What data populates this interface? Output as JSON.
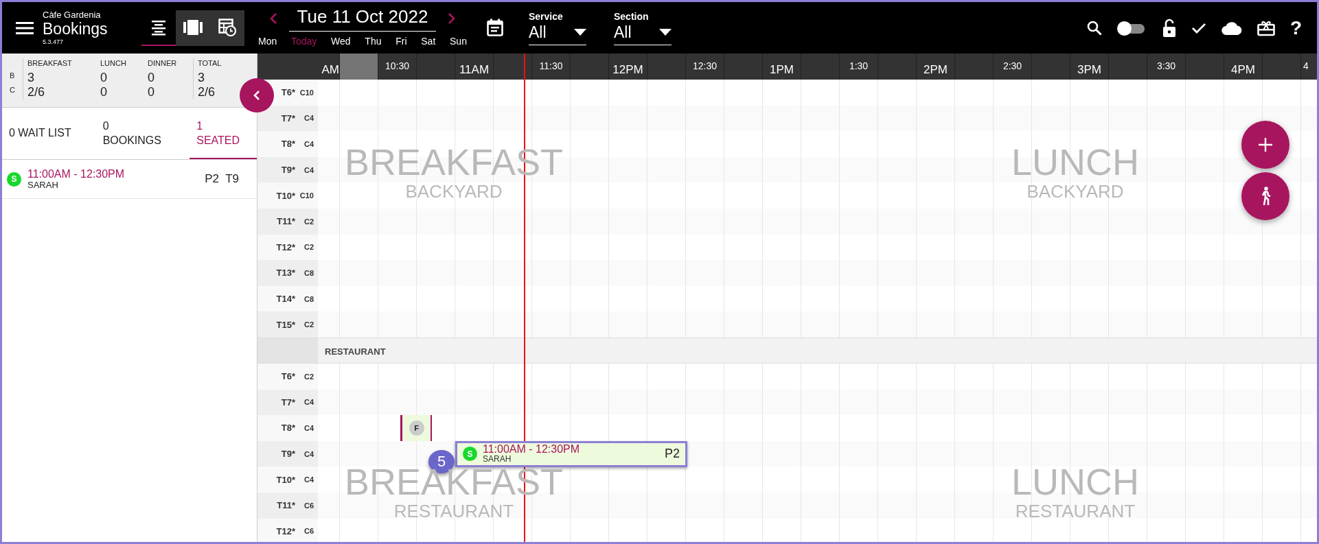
{
  "app": {
    "venue": "Càfe Gardenia",
    "title": "Bookings",
    "version": "5.3.477"
  },
  "view_modes": [
    {
      "kind": "list",
      "selected": true
    },
    {
      "kind": "floor",
      "selected": false
    },
    {
      "kind": "timeline",
      "selected": false
    }
  ],
  "date_nav": {
    "date": "Tue 11 Oct 2022",
    "days": [
      {
        "label": "Mon",
        "selected": false
      },
      {
        "label": "Today",
        "selected": true
      },
      {
        "label": "Wed",
        "selected": false
      },
      {
        "label": "Thu",
        "selected": false
      },
      {
        "label": "Fri",
        "selected": false
      },
      {
        "label": "Sat",
        "selected": false
      },
      {
        "label": "Sun",
        "selected": false
      }
    ]
  },
  "filters": [
    {
      "label": "Service",
      "value": "All"
    },
    {
      "label": "Section",
      "value": "All"
    }
  ],
  "toolbar": {
    "switch_on": false,
    "help": "?"
  },
  "summary": {
    "columns": [
      "BREAKFAST",
      "LUNCH",
      "DINNER",
      "TOTAL"
    ],
    "rows": [
      {
        "label": "B",
        "values": [
          "3",
          "0",
          "0",
          "3"
        ]
      },
      {
        "label": "C",
        "values": [
          "2/6",
          "0",
          "0",
          "2/6"
        ]
      }
    ]
  },
  "tabs": [
    {
      "label": "0 WAIT LIST",
      "selected": false
    },
    {
      "label": "0 BOOKINGS",
      "selected": false
    },
    {
      "label": "1 SEATED",
      "selected": true
    }
  ],
  "seated_list": [
    {
      "status": "S",
      "color": "#16d92c",
      "time": "11:00AM - 12:30PM",
      "name": "SARAH",
      "party": "P2",
      "table": "T9"
    }
  ],
  "timeline": {
    "slots": [
      {
        "label": "AM",
        "kind": "hour",
        "shaded": false
      },
      {
        "kind": "quarter",
        "shaded": true
      },
      {
        "label": "10:30",
        "kind": "half",
        "shaded": false
      },
      {
        "kind": "quarter",
        "shaded": false
      },
      {
        "label": "11AM",
        "kind": "hour",
        "shaded": false
      },
      {
        "kind": "quarter",
        "shaded": false
      },
      {
        "label": "11:30",
        "kind": "half",
        "shaded": false
      },
      {
        "kind": "quarter",
        "shaded": false
      },
      {
        "label": "12PM",
        "kind": "hour",
        "shaded": false
      },
      {
        "kind": "quarter",
        "shaded": false
      },
      {
        "label": "12:30",
        "kind": "half",
        "shaded": false
      },
      {
        "kind": "quarter",
        "shaded": false
      },
      {
        "label": "1PM",
        "kind": "hour",
        "shaded": false
      },
      {
        "kind": "quarter",
        "shaded": false
      },
      {
        "label": "1:30",
        "kind": "half",
        "shaded": false
      },
      {
        "kind": "quarter",
        "shaded": false
      },
      {
        "label": "2PM",
        "kind": "hour",
        "shaded": false
      },
      {
        "kind": "quarter",
        "shaded": false
      },
      {
        "label": "2:30",
        "kind": "half",
        "shaded": false
      },
      {
        "kind": "quarter",
        "shaded": false
      },
      {
        "label": "3PM",
        "kind": "hour",
        "shaded": false
      },
      {
        "kind": "quarter",
        "shaded": false
      },
      {
        "label": "3:30",
        "kind": "half",
        "shaded": false
      },
      {
        "kind": "quarter",
        "shaded": false
      },
      {
        "label": "4PM",
        "kind": "hour",
        "shaded": false
      },
      {
        "kind": "quarter",
        "shaded": false
      },
      {
        "label": "4",
        "kind": "half",
        "shaded": false
      }
    ],
    "sections": [
      {
        "watermarks": [
          {
            "service": "BREAKFAST",
            "area": "BACKYARD"
          },
          {
            "service": "LUNCH",
            "area": "BACKYARD"
          }
        ],
        "tables": [
          {
            "name": "T6*",
            "capacity": "C10"
          },
          {
            "name": "T7*",
            "capacity": "C4"
          },
          {
            "name": "T8*",
            "capacity": "C4"
          },
          {
            "name": "T9*",
            "capacity": "C4"
          },
          {
            "name": "T10*",
            "capacity": "C10"
          },
          {
            "name": "T11*",
            "capacity": "C2"
          },
          {
            "name": "T12*",
            "capacity": "C2"
          },
          {
            "name": "T13*",
            "capacity": "C8"
          },
          {
            "name": "T14*",
            "capacity": "C8"
          },
          {
            "name": "T15*",
            "capacity": "C2"
          }
        ]
      },
      {
        "name": "RESTAURANT",
        "watermarks": [
          {
            "service": "BREAKFAST",
            "area": "RESTAURANT"
          },
          {
            "service": "LUNCH",
            "area": "RESTAURANT"
          }
        ],
        "tables": [
          {
            "name": "T6*",
            "capacity": "C2"
          },
          {
            "name": "T7*",
            "capacity": "C4"
          },
          {
            "name": "T8*",
            "capacity": "C4",
            "blocks": [
              {
                "kind": "flag",
                "initial": "F"
              }
            ]
          },
          {
            "name": "T9*",
            "capacity": "C4",
            "blocks": [
              {
                "kind": "booking",
                "status": "S",
                "color": "#16d92c",
                "time": "11:00AM - 12:30PM",
                "name": "SARAH",
                "party": "P2",
                "highlighted": true,
                "callout": "5"
              }
            ]
          },
          {
            "name": "T10*",
            "capacity": "C4"
          },
          {
            "name": "T11*",
            "capacity": "C6"
          },
          {
            "name": "T12*",
            "capacity": "C6"
          }
        ]
      }
    ]
  }
}
